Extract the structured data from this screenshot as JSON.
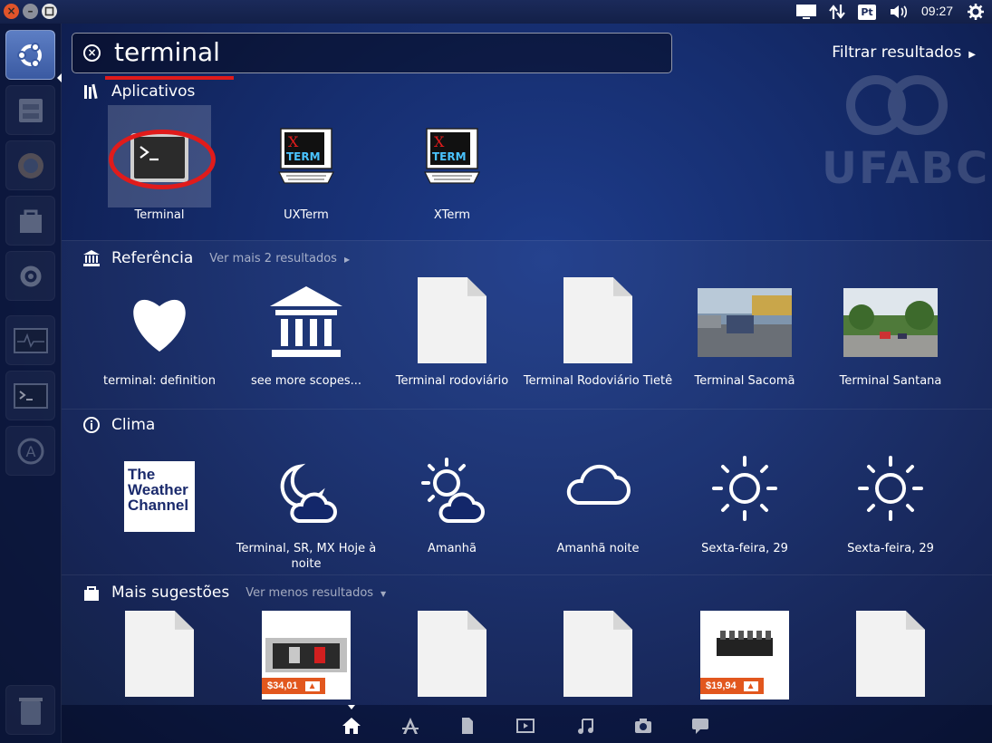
{
  "window_controls": {
    "close_icon": "close-icon",
    "min_icon": "minimize-icon",
    "max_icon": "maximize-icon"
  },
  "panel": {
    "language_indicator": "Pt",
    "clock": "09:27"
  },
  "search": {
    "query": "terminal",
    "filter_label": "Filtrar resultados"
  },
  "watermark": {
    "text": "UFABC"
  },
  "categories": {
    "apps": {
      "title": "Aplicativos",
      "items": [
        {
          "label": "Terminal",
          "icon": "terminal-icon"
        },
        {
          "label": "UXTerm",
          "icon": "xterm-icon"
        },
        {
          "label": "XTerm",
          "icon": "xterm-icon"
        }
      ],
      "xterm_line1": "X",
      "xterm_line2": "TERM"
    },
    "reference": {
      "title": "Referência",
      "more": "Ver mais 2 resultados",
      "items": [
        {
          "label": "terminal: definition"
        },
        {
          "label": "see more scopes..."
        },
        {
          "label": "Terminal rodoviário"
        },
        {
          "label": "Terminal Rodoviário Tietê"
        },
        {
          "label": "Terminal Sacomã"
        },
        {
          "label": "Terminal Santana"
        }
      ]
    },
    "weather": {
      "title": "Clima",
      "logo_text": [
        "The",
        "Weather",
        "Channel"
      ],
      "items": [
        {
          "label": ""
        },
        {
          "label": "Terminal, SR, MX Hoje à noite"
        },
        {
          "label": "Amanhã"
        },
        {
          "label": "Amanhã noite"
        },
        {
          "label": "Sexta-feira, 29"
        },
        {
          "label": "Sexta-feira, 29"
        }
      ]
    },
    "suggestions": {
      "title": "Mais sugestões",
      "less": "Ver menos resultados",
      "prices": [
        "$34,01",
        "$19,94"
      ]
    }
  },
  "lenses": [
    "home-lens",
    "applications-lens",
    "files-lens",
    "video-lens",
    "music-lens",
    "photos-lens",
    "social-lens"
  ]
}
